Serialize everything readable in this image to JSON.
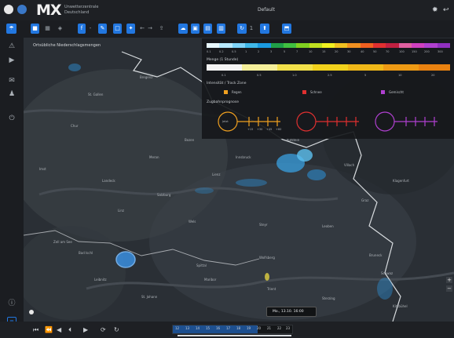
{
  "header": {
    "brand": "MX",
    "brand_sub_line1": "Unwetterzentrale",
    "brand_sub_line2": "Deutschland",
    "title": "Default"
  },
  "map": {
    "title": "Ortsübliche Niederschlagsmengen",
    "places": [
      "Bregenz",
      "St. Gallen",
      "Chur",
      "Bozen",
      "Meran",
      "Innsbruck",
      "Kufstein",
      "Lienz",
      "Villach",
      "Klagenfurt",
      "Graz",
      "Salzburg",
      "Linz",
      "Wels",
      "Steyr",
      "Leoben",
      "Zell am See",
      "Bad Ischl",
      "Spittal",
      "Wolfsberg",
      "Leibnitz",
      "Maribor",
      "Trient",
      "Sterzing",
      "Bruneck",
      "Schwaz",
      "Landeck",
      "Imst",
      "Kitzbühel",
      "St. Johann"
    ],
    "time_label": "Mo., 13.10. 16:00",
    "timeline_ticks": [
      "12",
      "13",
      "14",
      "15",
      "16",
      "17",
      "18",
      "19",
      "20",
      "21",
      "22",
      "23"
    ]
  },
  "legend": {
    "scale_ticks": [
      "0.1",
      "0.2",
      "0.5",
      "1",
      "2",
      "3",
      "5",
      "7",
      "10",
      "15",
      "20",
      "30",
      "40",
      "50",
      "70",
      "100",
      "150",
      "200",
      "300"
    ],
    "amount_title": "Menge (1 Stunde)",
    "amount_labels": [
      "0.1",
      "0.5",
      "1.0",
      "2.5",
      "5",
      "10",
      "20"
    ],
    "type_title": "Intensität / Track Zone",
    "types": [
      "Regen",
      "Schnee",
      "Gemischt"
    ],
    "track_title": "Zugbahnprognose",
    "track_labels": [
      "Jetzt",
      "+15",
      "+30",
      "+45",
      "+60"
    ]
  },
  "colors": {
    "accent": "#2277e0",
    "orange": "#f0a020",
    "red": "#e03030",
    "purple": "#b040d0"
  }
}
